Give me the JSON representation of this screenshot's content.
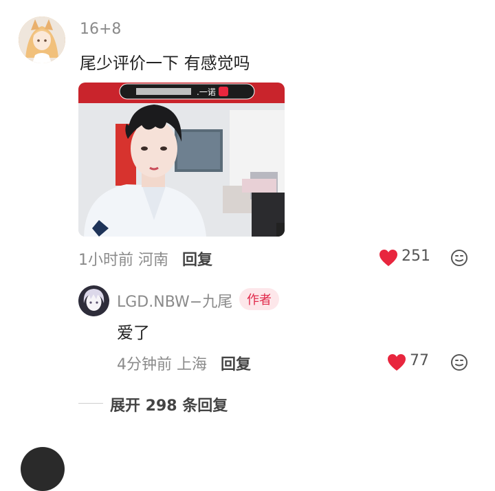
{
  "comment": {
    "username": "16+8",
    "text": "尾少评价一下 有感觉吗",
    "time_location": "1小时前 河南",
    "reply_label": "回复",
    "likes": "251",
    "image_overlay": ".一诺"
  },
  "reply": {
    "username": "LGD.NBW−九尾",
    "badge": "作者",
    "text": "爱了",
    "time_location": "4分钟前 上海",
    "reply_label": "回复",
    "likes": "77"
  },
  "expand": {
    "label": "展开 298 条回复"
  },
  "colors": {
    "like_red": "#e8263e",
    "badge_bg": "#fde7ea",
    "badge_text": "#e0294a",
    "meta_gray": "#8a8a8a"
  },
  "icons": {
    "like": "heart-icon",
    "emoji": "emoji-icon"
  }
}
